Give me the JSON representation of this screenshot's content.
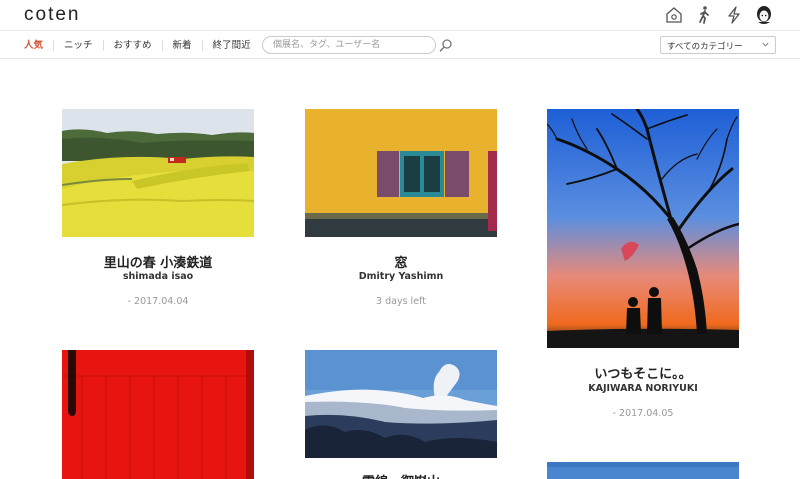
{
  "header": {
    "logo": "coten",
    "icons": [
      "home-icon",
      "walker-icon",
      "lightning-icon",
      "avatar"
    ]
  },
  "nav": {
    "tabs": [
      "人気",
      "ニッチ",
      "おすすめ",
      "新着",
      "終了間近"
    ],
    "active_tab": "人気",
    "search_placeholder": "個展名、タグ、ユーザー名",
    "category_value": "すべてのカテゴリー"
  },
  "cards": [
    {
      "title": "里山の春 小湊鉄道",
      "author": "shimada isao",
      "date": "- 2017.04.04"
    },
    {
      "title": "窓",
      "author": "Dmitry Yashimn",
      "date": "3 days left"
    },
    {
      "title": "いつもそこに。。",
      "author": "KAJIWARA NORIYUKI",
      "date": "- 2017.04.05"
    },
    {
      "title": "雪線　御嶽山",
      "author": "",
      "date": ""
    }
  ],
  "colors": {
    "accent": "#d0543a",
    "text": "#333333",
    "muted": "#999999"
  }
}
